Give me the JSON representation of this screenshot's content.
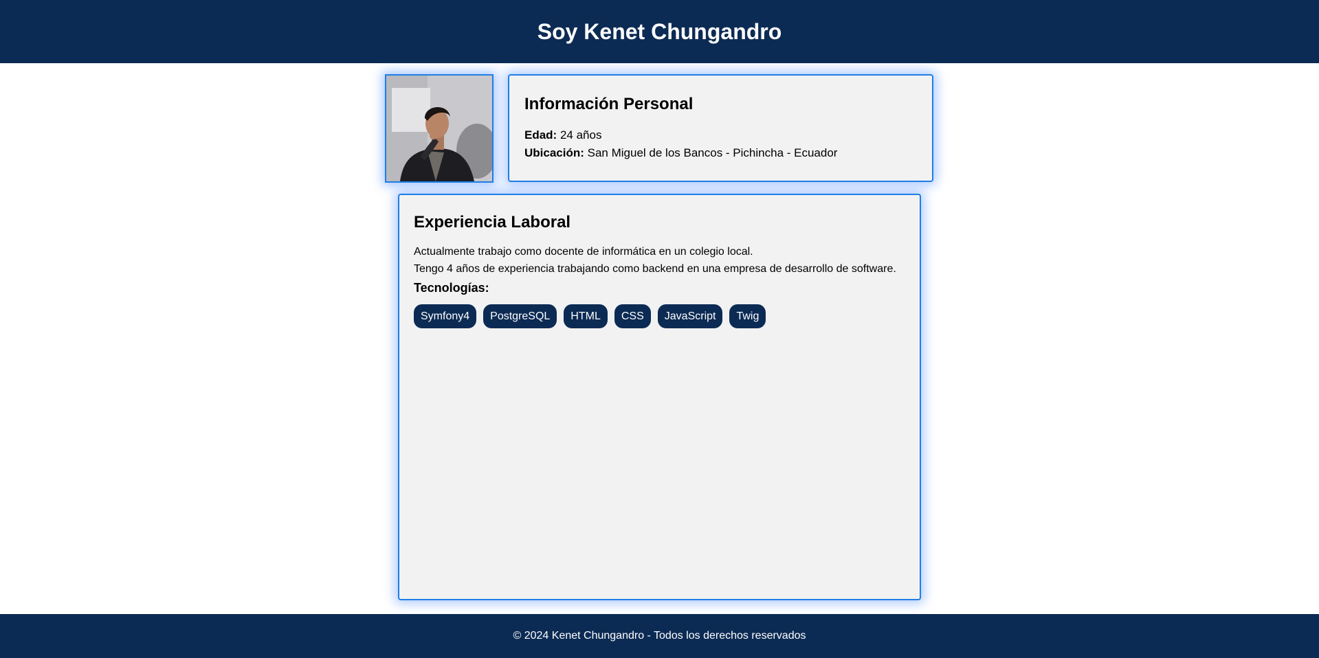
{
  "header": {
    "title": "Soy Kenet Chungandro"
  },
  "profile": {
    "photo_icon": "person-portrait-photo"
  },
  "personal_info": {
    "heading": "Información Personal",
    "age_label": "Edad:",
    "age_value": "24 años",
    "location_label": "Ubicación:",
    "location_value": "San Miguel de los Bancos - Pichincha - Ecuador"
  },
  "experience": {
    "heading": "Experiencia Laboral",
    "lines": [
      "Actualmente trabajo como docente de informática en un colegio local.",
      "Tengo 4 años de experiencia trabajando como backend en una empresa de desarrollo de software."
    ],
    "tech_heading": "Tecnologías:",
    "technologies": [
      "Symfony4",
      "PostgreSQL",
      "HTML",
      "CSS",
      "JavaScript",
      "Twig"
    ]
  },
  "footer": {
    "text": "© 2024 Kenet Chungandro - Todos los derechos reservados"
  },
  "colors": {
    "navy": "#0c2b54",
    "card_border": "#1e7ee6",
    "card_bg": "#f2f2f2"
  }
}
